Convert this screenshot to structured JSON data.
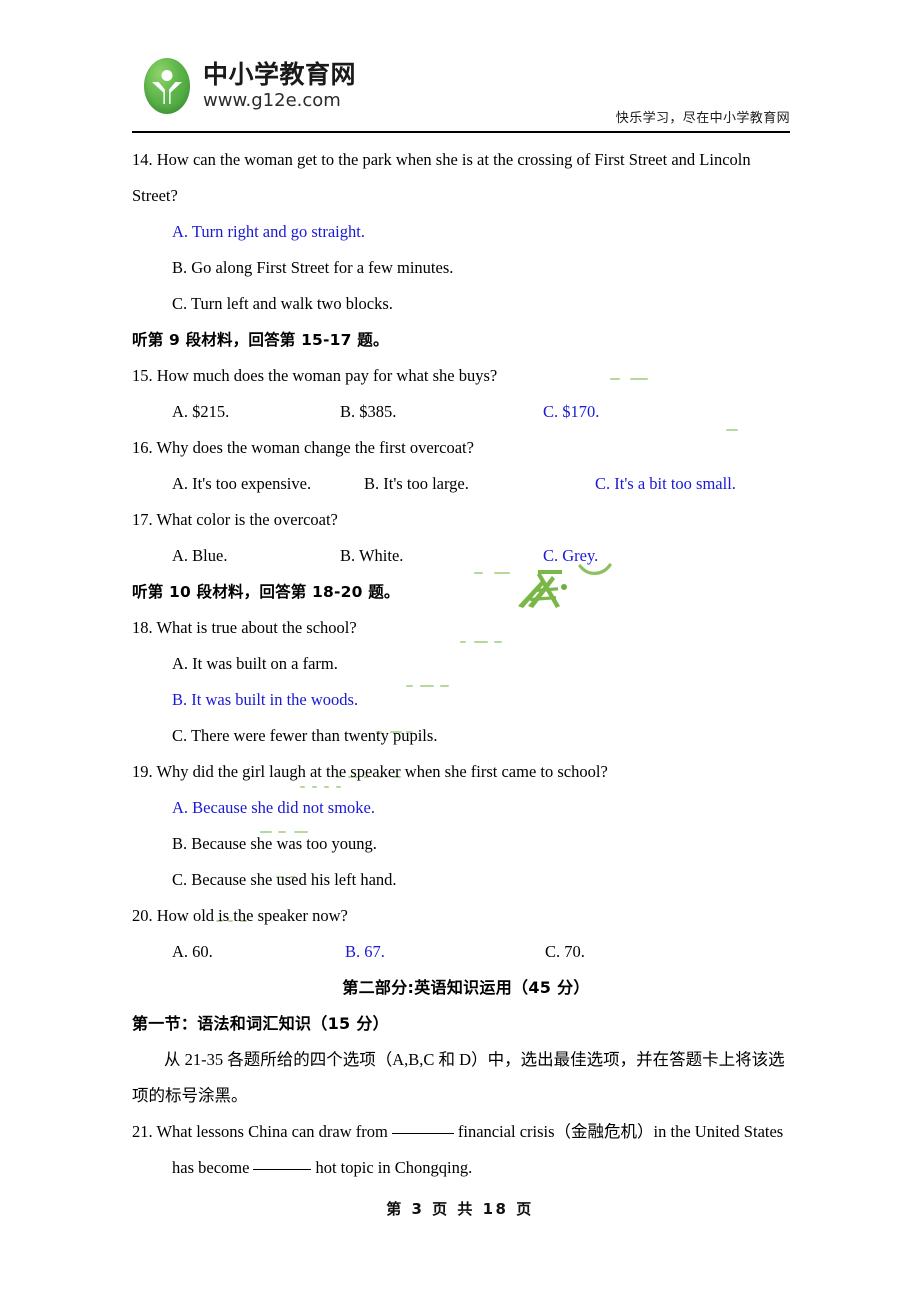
{
  "header": {
    "logo_cn": "中小学教育网",
    "logo_url": "www.g12e.com",
    "tagline": "快乐学习，尽在中小学教育网"
  },
  "colors": {
    "answer_blue": "#1919d6",
    "logo_green": "#5cb54a",
    "watermark_green": "#7ab648"
  },
  "questions": {
    "q14": {
      "stem_line1": "14. How can the woman get to the park when she is at the crossing of First Street and Lincoln",
      "stem_line2": "Street?",
      "optA": "A. Turn right and go straight.",
      "optB": "B. Go along First Street for a few minutes.",
      "optC": "C. Turn left and walk two blocks."
    },
    "section9": "听第 9 段材料，回答第 15-17 题。",
    "q15": {
      "stem": "15. How much does the woman pay for what she buys?",
      "optA": "A. $215.",
      "optB": "B. $385.",
      "optC": "C. $170."
    },
    "q16": {
      "stem": "16. Why does the woman change the first overcoat?",
      "optA": "A. It's too expensive.",
      "optB": "B. It's too large.",
      "optC": "C. It's a bit too small."
    },
    "q17": {
      "stem": "17. What color is the overcoat?",
      "optA": "A. Blue.",
      "optB": "B. White.",
      "optC": "C. Grey."
    },
    "section10": "听第 10 段材料，回答第 18-20 题。",
    "q18": {
      "stem": "18. What is true about the school?",
      "optA": "A. It was built on a farm.",
      "optB": "B. It was built in the woods.",
      "optC": "C. There were fewer than twenty pupils."
    },
    "q19": {
      "stem": "19. Why did the girl laugh at the speaker when she first came to school?",
      "optA": "A. Because she did not smoke.",
      "optB": "B. Because she was too young.",
      "optC": "C. Because she used his left hand."
    },
    "q20": {
      "stem": "20. How old is the speaker now?",
      "optA": "A. 60.",
      "optB": "B. 67.",
      "optC": "C. 70."
    },
    "q21": {
      "line1_a": "21. What lessons China can draw from",
      "line1_b": "financial crisis（金融危机）in the United States",
      "line2_a": "has become",
      "line2_b": "hot topic in Chongqing."
    }
  },
  "part2": {
    "title": "第二部分:英语知识运用（45 分）",
    "section1_title": "第一节：语法和词汇知识（15 分）",
    "instruction_line1": "从 21-35 各题所给的四个选项（A,B,C 和 D）中，选出最佳选项，并在答题卡上将该选",
    "instruction_line2": "项的标号涂黑。"
  },
  "footer": {
    "page_label": "第 3 页 共 18 页"
  }
}
